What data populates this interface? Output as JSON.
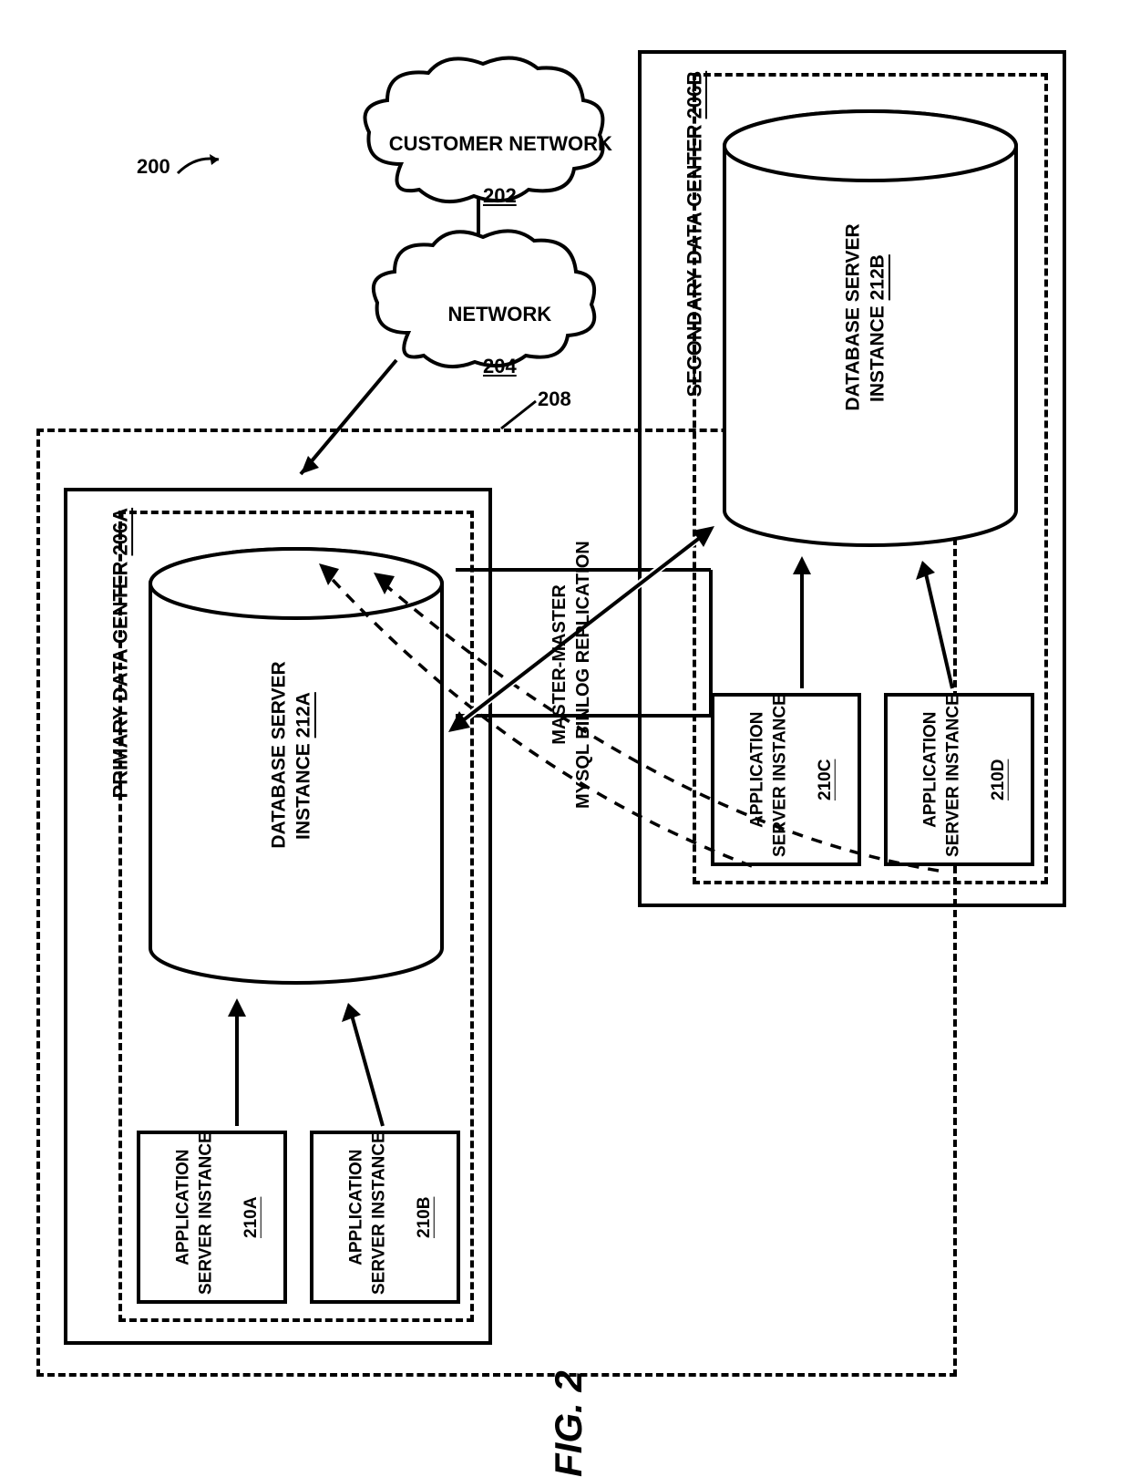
{
  "figure": {
    "ref200": "200",
    "caption": "FIG. 2"
  },
  "clouds": {
    "customer_network": "CUSTOMER NETWORK",
    "customer_network_ref": "202",
    "network": "NETWORK",
    "network_ref": "204"
  },
  "outer_ref": "208",
  "primary": {
    "title": "PRIMARY DATA CENTER ",
    "ref": "206A",
    "app_a": "APPLICATION\nSERVER INSTANCE",
    "app_a_ref": "210A",
    "app_b": "APPLICATION\nSERVER INSTANCE",
    "app_b_ref": "210B",
    "db": "DATABASE SERVER\nINSTANCE ",
    "db_ref": "212A"
  },
  "secondary": {
    "title": "SECONDARY DATA CENTER ",
    "ref": "206B",
    "app_c": "APPLICATION\nSERVER INSTANCE",
    "app_c_ref": "210C",
    "app_d": "APPLICATION\nSERVER INSTANCE",
    "app_d_ref": "210D",
    "db": "DATABASE SERVER\nINSTANCE ",
    "db_ref": "212B"
  },
  "replication": "MASTER-MASTER\nMYSQL BINLOG REPLICATION"
}
